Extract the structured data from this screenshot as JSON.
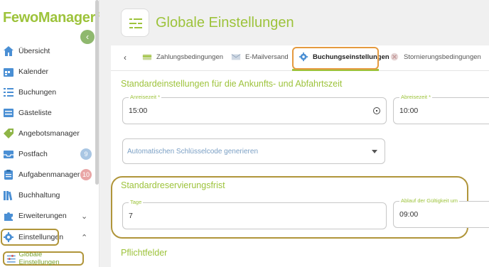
{
  "brand": {
    "name": "FewoManager",
    "mark": "®",
    "accent": "#9dc33b"
  },
  "sidebar": {
    "items": [
      {
        "label": "Übersicht",
        "icon": "home-icon"
      },
      {
        "label": "Kalender",
        "icon": "calendar-icon"
      },
      {
        "label": "Buchungen",
        "icon": "list-icon"
      },
      {
        "label": "Gästeliste",
        "icon": "guestlist-icon"
      },
      {
        "label": "Angebotsmanager",
        "icon": "tag-icon"
      },
      {
        "label": "Postfach",
        "icon": "inbox-icon",
        "badge": "9"
      },
      {
        "label": "Aufgabenmanager",
        "icon": "clipboard-icon",
        "badge": "10"
      },
      {
        "label": "Buchhaltung",
        "icon": "books-icon"
      },
      {
        "label": "Erweiterungen",
        "icon": "puzzle-icon"
      },
      {
        "label": "Einstellungen",
        "icon": "gear-icon"
      }
    ],
    "sub_item": {
      "label": "Globale Einstellungen",
      "icon": "sliders-icon"
    }
  },
  "page": {
    "title": "Globale Einstellungen"
  },
  "tabs": [
    {
      "label": "Zahlungsbedingungen",
      "icon": "payment-icon"
    },
    {
      "label": "E-Mailversand",
      "icon": "mail-icon"
    },
    {
      "label": "Buchungseinstellungen",
      "icon": "gear-icon",
      "active": true
    },
    {
      "label": "Stornierungsbedingungen",
      "icon": "cancel-icon"
    }
  ],
  "sections": {
    "arrival": {
      "title": "Standardeinstellungen für die Ankunfts- und Abfahrtszeit",
      "arrival_label": "Anreisezeit *",
      "arrival_value": "15:00",
      "departure_label": "Abreisezeit *",
      "departure_value": "10:00",
      "keycode_select": "Automatischen Schlüsselcode generieren"
    },
    "reservation": {
      "title": "Standardreservierungsfrist",
      "days_label": "Tage",
      "days_value": "7",
      "expiry_label": "Ablauf der Gültigkeit um",
      "expiry_value": "09:00"
    },
    "required": {
      "title": "Pflichtfelder"
    }
  }
}
